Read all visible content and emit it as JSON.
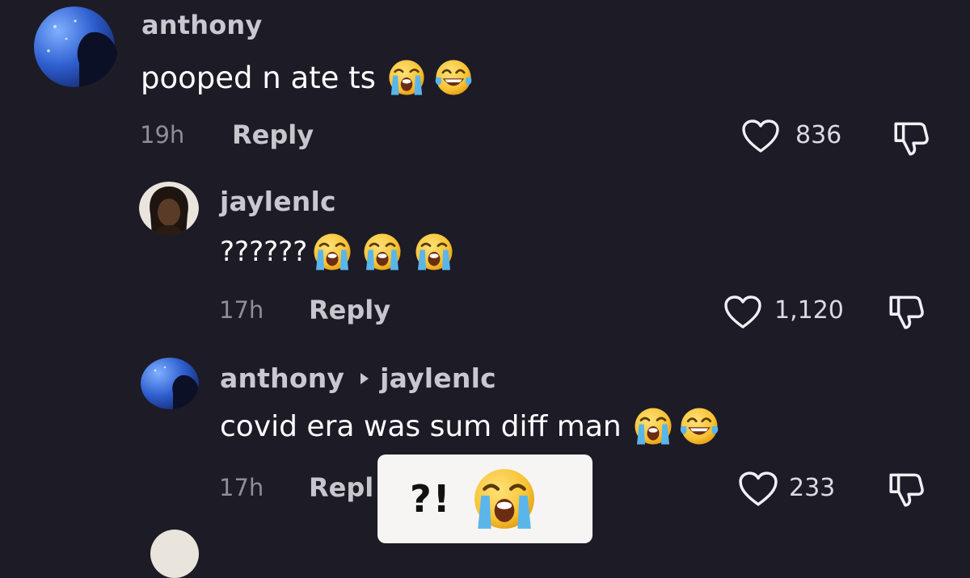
{
  "comments": [
    {
      "username": "anthony",
      "text": "pooped n ate ts",
      "emojis": [
        "loudly-crying-face",
        "face-with-tears-of-joy"
      ],
      "time": "19h",
      "reply_label": "Reply",
      "likes": "836"
    },
    {
      "username": "jaylenlc",
      "text": "??????",
      "emojis": [
        "loudly-crying-face",
        "loudly-crying-face",
        "loudly-crying-face"
      ],
      "time": "17h",
      "reply_label": "Reply",
      "likes": "1,120"
    },
    {
      "username": "anthony",
      "reply_to": "jaylenlc",
      "text": "covid era was sum diff man",
      "emojis": [
        "loudly-crying-face",
        "face-with-tears-of-joy"
      ],
      "time": "17h",
      "reply_label": "Repl",
      "likes": "233"
    }
  ],
  "overlay": {
    "text": "?!",
    "emoji": "loudly-crying-face",
    "background": "#f6f5f3"
  },
  "icons": {
    "like": "heart-outline-icon",
    "dislike": "thumbs-down-outline-icon"
  },
  "colors": {
    "background": "#1c1b26",
    "username": "#c9c8cf",
    "text": "#ffffff",
    "muted": "#8f8e98",
    "emoji_yellow": "#f7c233",
    "tears_blue": "#5ab6ea"
  }
}
